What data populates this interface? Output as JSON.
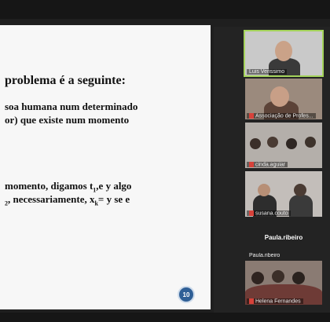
{
  "slide": {
    "line1": "problema é a seguinte:",
    "line2": "soa humana num determinado",
    "line3": "or) que existe num momento",
    "line4_pre": "momento, digamos t",
    "line4_sub": "1",
    "line4_post": ",e y algo",
    "line5_pre": "",
    "line5_sub": "2",
    "line5_post": ", necessariamente, x",
    "line5_sub2": "k",
    "line5_end": "= y se e",
    "page_number": "10"
  },
  "participants": [
    {
      "name": "Luis Verissimo",
      "muted": false
    },
    {
      "name": "Associação de Profes...",
      "muted": true
    },
    {
      "name": "cinda.aguiar",
      "muted": true
    },
    {
      "name": "susana.couto",
      "muted": true
    },
    {
      "name": "Paula.ribeiro",
      "label": "Paula.ribeiro",
      "muted": false
    },
    {
      "name": "Helena Fernandes",
      "muted": true
    }
  ],
  "colors": {
    "active_speaker": "#a4d35b",
    "muted": "#d7423a",
    "page_badge": "#2f5f96"
  }
}
